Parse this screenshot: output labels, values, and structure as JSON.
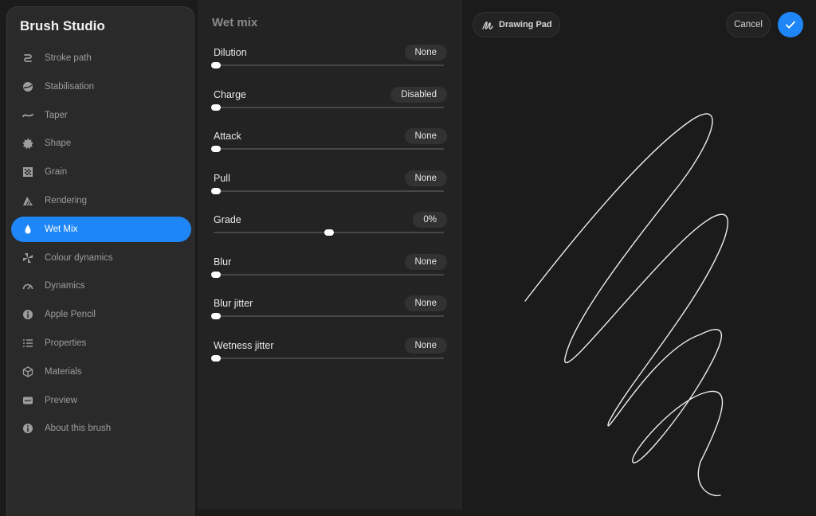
{
  "sidebar": {
    "title": "Brush Studio",
    "items": [
      {
        "label": "Stroke path",
        "icon": "stroke-path-icon"
      },
      {
        "label": "Stabilisation",
        "icon": "stabilisation-icon"
      },
      {
        "label": "Taper",
        "icon": "taper-icon"
      },
      {
        "label": "Shape",
        "icon": "shape-icon"
      },
      {
        "label": "Grain",
        "icon": "grain-icon"
      },
      {
        "label": "Rendering",
        "icon": "rendering-icon"
      },
      {
        "label": "Wet Mix",
        "icon": "wet-mix-icon",
        "active": true
      },
      {
        "label": "Colour dynamics",
        "icon": "colour-dynamics-icon"
      },
      {
        "label": "Dynamics",
        "icon": "dynamics-icon"
      },
      {
        "label": "Apple Pencil",
        "icon": "apple-pencil-icon"
      },
      {
        "label": "Properties",
        "icon": "properties-icon"
      },
      {
        "label": "Materials",
        "icon": "materials-icon"
      },
      {
        "label": "Preview",
        "icon": "preview-icon"
      },
      {
        "label": "About this brush",
        "icon": "about-icon"
      }
    ]
  },
  "panel": {
    "title": "Wet mix",
    "settings": [
      {
        "label": "Dilution",
        "value": "None",
        "level": 0
      },
      {
        "label": "Charge",
        "value": "Disabled",
        "level": 0
      },
      {
        "label": "Attack",
        "value": "None",
        "level": 0
      },
      {
        "label": "Pull",
        "value": "None",
        "level": 0
      },
      {
        "label": "Grade",
        "value": "0%",
        "level": 0.5
      },
      {
        "label": "Blur",
        "value": "None",
        "level": 0
      },
      {
        "label": "Blur jitter",
        "value": "None",
        "level": 0
      },
      {
        "label": "Wetness jitter",
        "value": "None",
        "level": 0
      }
    ]
  },
  "pad": {
    "drawing_pad_label": "Drawing Pad",
    "cancel_label": "Cancel"
  },
  "colors": {
    "accent": "#1e86f6",
    "background": "#1b1b1b",
    "sidebar": "#2a2a2a"
  }
}
